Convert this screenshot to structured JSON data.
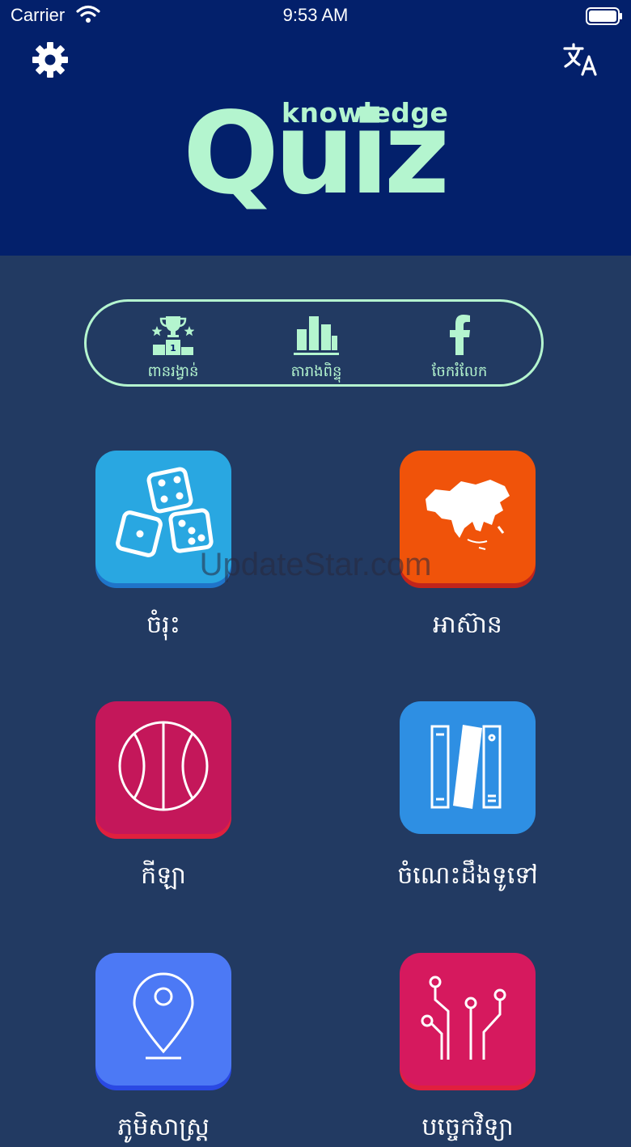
{
  "status": {
    "carrier": "Carrier",
    "time": "9:53 AM"
  },
  "logo": {
    "small": "knowledge",
    "big": "Quiz"
  },
  "menu": [
    {
      "label": "ពានរង្វាន់",
      "icon": "trophy-podium-icon"
    },
    {
      "label": "តារាងពិន្ទុ",
      "icon": "bar-chart-icon"
    },
    {
      "label": "ចែករំលែក",
      "icon": "facebook-icon"
    }
  ],
  "categories": [
    {
      "label": "ចំរុះ",
      "icon": "dice-icon",
      "color": "#29a7e1"
    },
    {
      "label": "អាស៊ាន",
      "icon": "asia-map-icon",
      "color": "#f0530a"
    },
    {
      "label": "កីឡា",
      "icon": "basketball-icon",
      "color": "#c4175a"
    },
    {
      "label": "ចំណេះដឹងទូទៅ",
      "icon": "books-icon",
      "color": "#2e8fe3"
    },
    {
      "label": "ភូមិសាស្ត្រ",
      "icon": "location-pin-icon",
      "color": "#4c79f5"
    },
    {
      "label": "បច្ចេកវិទ្យា",
      "icon": "circuit-icon",
      "color": "#d6195e"
    }
  ],
  "watermark": "UpdateStar.com"
}
